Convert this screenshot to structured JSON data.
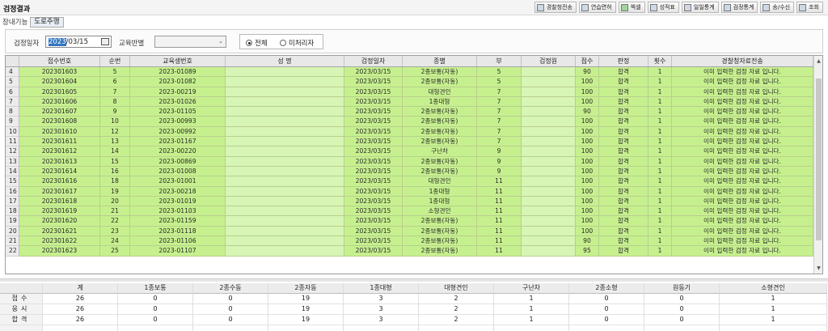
{
  "app": {
    "title": "검정결과"
  },
  "toolbar": [
    {
      "label": "경찰청전송",
      "icon": "upload-icon"
    },
    {
      "label": "연습면허",
      "icon": "license-icon"
    },
    {
      "label": "엑셀",
      "icon": "excel-icon"
    },
    {
      "label": "성적표",
      "icon": "report-icon"
    },
    {
      "label": "일일통계",
      "icon": "daily-stats-icon"
    },
    {
      "label": "검정통계",
      "icon": "exam-stats-icon"
    },
    {
      "label": "송/수신",
      "icon": "transfer-icon"
    },
    {
      "label": "조회",
      "icon": "search-icon"
    }
  ],
  "subtabs": {
    "label": "장내기능",
    "active": "도로주행"
  },
  "filter": {
    "date_label": "검정일자",
    "date_value_selected": "2023",
    "date_value_rest": "/03/15",
    "edu_label": "교육반별",
    "edu_value": "",
    "radio_all": "전체",
    "radio_pending": "미처리자"
  },
  "grid": {
    "columns": [
      "",
      "접수번호",
      "순번",
      "교육생번호",
      "성 명",
      "검정일자",
      "종별",
      "부",
      "검정원",
      "점수",
      "판정",
      "횟수",
      "경찰청자료전송"
    ],
    "rows": [
      [
        "4",
        "202301603",
        "5",
        "2023-01089",
        "",
        "2023/03/15",
        "2종보통(자동)",
        "5",
        "",
        "90",
        "합격",
        "1",
        "이미 입력한 검정 자료 입니다."
      ],
      [
        "5",
        "202301604",
        "6",
        "2023-01082",
        "",
        "2023/03/15",
        "2종보통(자동)",
        "5",
        "",
        "100",
        "합격",
        "1",
        "이미 입력한 검정 자료 입니다."
      ],
      [
        "6",
        "202301605",
        "7",
        "2023-00219",
        "",
        "2023/03/15",
        "대형견인",
        "7",
        "",
        "100",
        "합격",
        "1",
        "이미 입력한 검정 자료 입니다."
      ],
      [
        "7",
        "202301606",
        "8",
        "2023-01026",
        "",
        "2023/03/15",
        "1종대형",
        "7",
        "",
        "100",
        "합격",
        "1",
        "이미 입력한 검정 자료 입니다."
      ],
      [
        "8",
        "202301607",
        "9",
        "2023-01105",
        "",
        "2023/03/15",
        "2종보통(자동)",
        "7",
        "",
        "90",
        "합격",
        "1",
        "이미 입력한 검정 자료 입니다."
      ],
      [
        "9",
        "202301608",
        "10",
        "2023-00993",
        "",
        "2023/03/15",
        "2종보통(자동)",
        "7",
        "",
        "100",
        "합격",
        "1",
        "이미 입력한 검정 자료 입니다."
      ],
      [
        "10",
        "202301610",
        "12",
        "2023-00992",
        "",
        "2023/03/15",
        "2종보통(자동)",
        "7",
        "",
        "100",
        "합격",
        "1",
        "이미 입력한 검정 자료 입니다."
      ],
      [
        "11",
        "202301611",
        "13",
        "2023-01167",
        "",
        "2023/03/15",
        "2종보통(자동)",
        "7",
        "",
        "100",
        "합격",
        "1",
        "이미 입력한 검정 자료 입니다."
      ],
      [
        "12",
        "202301612",
        "14",
        "2023-00220",
        "",
        "2023/03/15",
        "구난차",
        "9",
        "",
        "100",
        "합격",
        "1",
        "이미 입력한 검정 자료 입니다."
      ],
      [
        "13",
        "202301613",
        "15",
        "2023-00869",
        "",
        "2023/03/15",
        "2종보통(자동)",
        "9",
        "",
        "100",
        "합격",
        "1",
        "이미 입력한 검정 자료 입니다."
      ],
      [
        "14",
        "202301614",
        "16",
        "2023-01008",
        "",
        "2023/03/15",
        "2종보통(자동)",
        "9",
        "",
        "100",
        "합격",
        "1",
        "이미 입력한 검정 자료 입니다."
      ],
      [
        "15",
        "202301616",
        "18",
        "2023-01001",
        "",
        "2023/03/15",
        "대형견인",
        "11",
        "",
        "100",
        "합격",
        "1",
        "이미 입력한 검정 자료 입니다."
      ],
      [
        "16",
        "202301617",
        "19",
        "2023-00218",
        "",
        "2023/03/15",
        "1종대형",
        "11",
        "",
        "100",
        "합격",
        "1",
        "이미 입력한 검정 자료 입니다."
      ],
      [
        "17",
        "202301618",
        "20",
        "2023-01019",
        "",
        "2023/03/15",
        "1종대형",
        "11",
        "",
        "100",
        "합격",
        "1",
        "이미 입력한 검정 자료 입니다."
      ],
      [
        "18",
        "202301619",
        "21",
        "2023-01103",
        "",
        "2023/03/15",
        "소형견인",
        "11",
        "",
        "100",
        "합격",
        "1",
        "이미 입력한 검정 자료 입니다."
      ],
      [
        "19",
        "202301620",
        "22",
        "2023-01159",
        "",
        "2023/03/15",
        "2종보통(자동)",
        "11",
        "",
        "100",
        "합격",
        "1",
        "이미 입력한 검정 자료 입니다."
      ],
      [
        "20",
        "202301621",
        "23",
        "2023-01118",
        "",
        "2023/03/15",
        "2종보통(자동)",
        "11",
        "",
        "100",
        "합격",
        "1",
        "이미 입력한 검정 자료 입니다."
      ],
      [
        "21",
        "202301622",
        "24",
        "2023-01106",
        "",
        "2023/03/15",
        "2종보통(자동)",
        "11",
        "",
        "90",
        "합격",
        "1",
        "이미 입력한 검정 자료 입니다."
      ],
      [
        "22",
        "202301623",
        "25",
        "2023-01107",
        "",
        "2023/03/15",
        "2종보통(자동)",
        "11",
        "",
        "95",
        "합격",
        "1",
        "이미 입력한 검정 자료 입니다."
      ]
    ]
  },
  "summary": {
    "columns": [
      "",
      "계",
      "1종보통",
      "2종수동",
      "2종자동",
      "1종대형",
      "대형견인",
      "구난차",
      "2종소형",
      "원동기",
      "소형견인"
    ],
    "rows": [
      [
        "접수",
        "26",
        "0",
        "0",
        "19",
        "3",
        "2",
        "1",
        "0",
        "0",
        "1"
      ],
      [
        "응시",
        "26",
        "0",
        "0",
        "19",
        "3",
        "2",
        "1",
        "0",
        "0",
        "1"
      ],
      [
        "합격",
        "26",
        "0",
        "0",
        "19",
        "3",
        "2",
        "1",
        "0",
        "0",
        "1"
      ],
      [
        "",
        "",
        "",
        "",
        "",
        "",
        "",
        "",
        "",
        "",
        ""
      ]
    ]
  },
  "colors": {
    "row_bg": "#c6f08e",
    "header_bg": "#e8e8e8",
    "accent": "#3276c3"
  }
}
